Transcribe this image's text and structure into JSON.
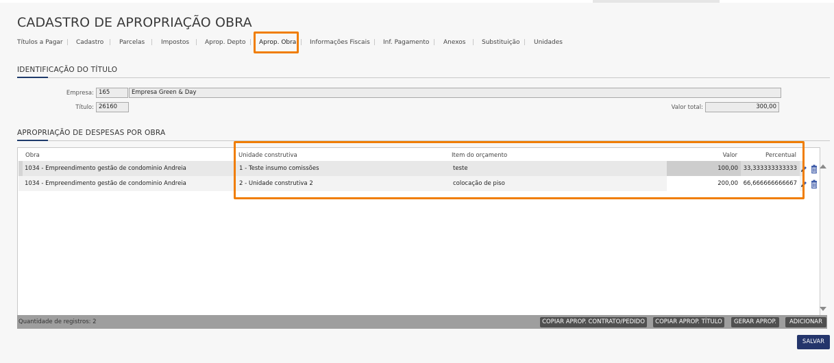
{
  "page": {
    "title": "CADASTRO DE APROPRIAÇÃO OBRA"
  },
  "tabs": [
    {
      "label": "Títulos a Pagar"
    },
    {
      "label": "Cadastro"
    },
    {
      "label": "Parcelas"
    },
    {
      "label": "Impostos"
    },
    {
      "label": "Aprop. Depto"
    },
    {
      "label": "Aprop. Obra",
      "active": true
    },
    {
      "label": "Informações Fiscais"
    },
    {
      "label": "Inf. Pagamento"
    },
    {
      "label": "Anexos"
    },
    {
      "label": "Substituição"
    },
    {
      "label": "Unidades"
    }
  ],
  "identificacao": {
    "section_title": "IDENTIFICAÇÃO DO TÍTULO",
    "empresa_label": "Empresa:",
    "empresa_code": "165",
    "empresa_name": "Empresa Green & Day",
    "titulo_label": "Título:",
    "titulo_value": "26160",
    "valor_total_label": "Valor total:",
    "valor_total_value": "300,00"
  },
  "apropriacao": {
    "section_title": "APROPRIAÇÃO DE DESPESAS POR OBRA",
    "columns": {
      "obra": "Obra",
      "unidade": "Unidade construtiva",
      "item": "Item do orçamento",
      "valor": "Valor",
      "percentual": "Percentual"
    },
    "rows": [
      {
        "obra": "1034 - Empreendimento gestão de condominio Andreia",
        "unidade": "1 - Teste insumo comissões",
        "item": "teste",
        "valor": "100,00",
        "percentual": "33,333333333333"
      },
      {
        "obra": "1034 - Empreendimento gestão de condominio Andreia",
        "unidade": "2 - Unidade construtiva 2",
        "item": "colocação de piso",
        "valor": "200,00",
        "percentual": "66,666666666667"
      }
    ],
    "footer": {
      "count_text": "Quantidade de registros: 2",
      "buttons": {
        "copiar_contrato": "COPIAR APROP. CONTRATO/PEDIDO",
        "copiar_titulo": "COPIAR APROP. TÍTULO",
        "gerar": "GERAR APROP.",
        "adicionar": "ADICIONAR"
      }
    }
  },
  "actions": {
    "save_label": "SALVAR"
  },
  "colors": {
    "highlight": "#f07d00",
    "accent_navy": "#24356b",
    "footer_bar": "#9e9e9e",
    "button_dark": "#505050"
  }
}
